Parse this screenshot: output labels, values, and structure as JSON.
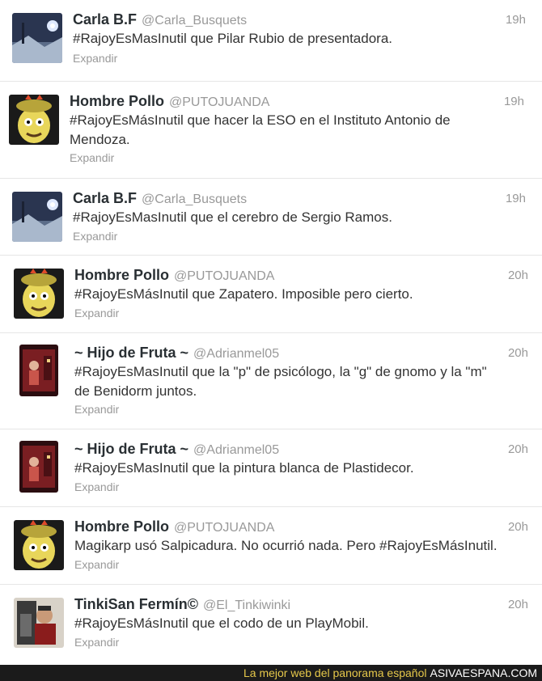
{
  "tweets": [
    {
      "name": "Carla B.F",
      "handle": "@Carla_Busquets",
      "time": "19h",
      "lines": [
        "#RajoyEsMasInutil que Pilar Rubio de presentadora."
      ],
      "expand": "Expandir",
      "avatar": "night-sky-avatar"
    },
    {
      "name": "Hombre Pollo",
      "handle": "@PUTOJUANDA",
      "time": "19h",
      "lines": [
        "#RajoyEsMásInutil que hacer la ESO en el Instituto Antonio de",
        "Mendoza."
      ],
      "expand": "Expandir",
      "avatar": "cartoon-face-avatar"
    },
    {
      "name": "Carla B.F",
      "handle": "@Carla_Busquets",
      "time": "19h",
      "lines": [
        "#RajoyEsMasInutil que el cerebro de Sergio Ramos."
      ],
      "expand": "Expandir",
      "avatar": "night-sky-avatar"
    },
    {
      "name": "Hombre Pollo",
      "handle": "@PUTOJUANDA",
      "time": "20h",
      "lines": [
        "#RajoyEsMásInutil que Zapatero. Imposible pero cierto."
      ],
      "expand": "Expandir",
      "avatar": "cartoon-face-avatar"
    },
    {
      "name": "~ Hijo de Fruta ~",
      "handle": "@Adrianmel05",
      "time": "20h",
      "lines": [
        "#RajoyEsMasInutil que la \"p\" de psicólogo, la \"g\" de gnomo y la \"m\"",
        "de Benidorm juntos."
      ],
      "expand": "Expandir",
      "avatar": "red-figures-avatar"
    },
    {
      "name": "~ Hijo de Fruta ~",
      "handle": "@Adrianmel05",
      "time": "20h",
      "lines": [
        "#RajoyEsMasInutil que la pintura blanca de Plastidecor."
      ],
      "expand": "Expandir",
      "avatar": "red-figures-avatar"
    },
    {
      "name": "Hombre Pollo",
      "handle": "@PUTOJUANDA",
      "time": "20h",
      "lines": [
        "Magikarp usó Salpicadura. No ocurrió nada. Pero #RajoyEsMásInutil."
      ],
      "expand": "Expandir",
      "avatar": "cartoon-face-avatar"
    },
    {
      "name": "TinkiSan Fermín©",
      "handle": "@El_Tinkiwinki",
      "time": "20h",
      "lines": [
        "#RajoyEsMásInutil que el codo de un PlayMobil."
      ],
      "expand": "Expandir",
      "avatar": "warrior-avatar"
    }
  ],
  "footer": {
    "tagline": "La mejor web del panorama español",
    "brand": "ASIVAESPANA.COM"
  }
}
